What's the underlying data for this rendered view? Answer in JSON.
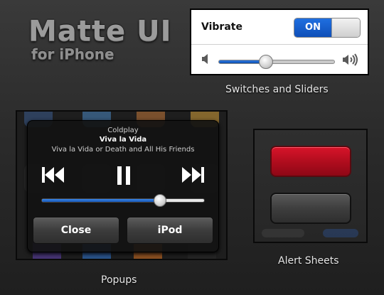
{
  "title": {
    "main": "Matte UI",
    "sub": "for iPhone"
  },
  "settings": {
    "vibrate_label": "Vibrate",
    "vibrate_state": "ON",
    "volume_level": 0.41
  },
  "captions": {
    "switches": "Switches and Sliders",
    "popups": "Popups",
    "alerts": "Alert Sheets"
  },
  "popup": {
    "artist": "Coldplay",
    "song": "Viva la Vida",
    "album": "Viva la Vida or Death and All His Friends",
    "progress": 0.73,
    "buttons": {
      "close": "Close",
      "ipod": "iPod"
    }
  },
  "colors": {
    "accent_blue": "#1f6fe0",
    "alert_red": "#c4102a",
    "background": "#2b2b2b"
  },
  "icons": {
    "volume_min": "speaker-icon",
    "volume_max": "speaker-loud-icon",
    "prev": "previous-track-icon",
    "pause": "pause-icon",
    "next": "next-track-icon"
  }
}
